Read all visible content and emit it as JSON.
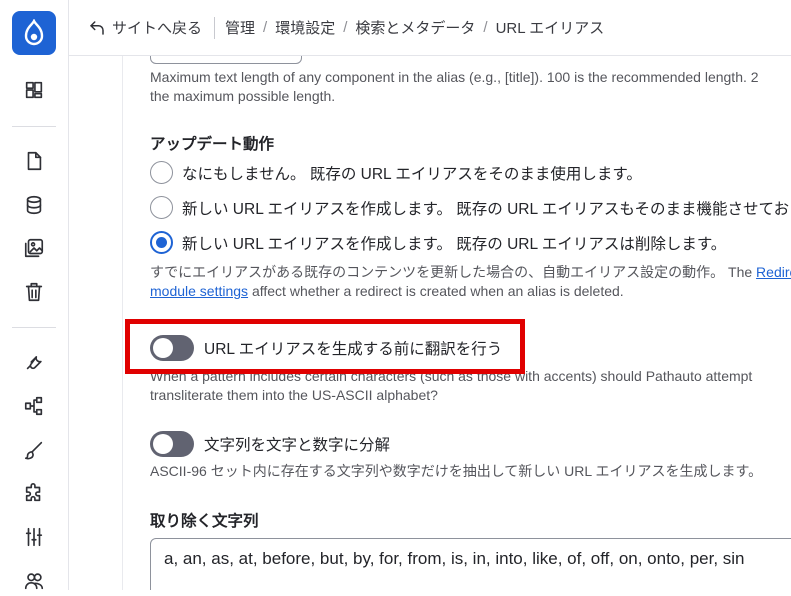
{
  "topbar": {
    "back_label": "サイトへ戻る",
    "breadcrumbs": [
      "管理",
      "環境設定",
      "検索とメタデータ",
      "URL エイリアス"
    ]
  },
  "sidebar": {
    "icons": [
      "drupal-logo-icon",
      "dashboard-icon",
      "content-icon",
      "structure-icon",
      "media-icon",
      "trash-icon",
      "tools-icon",
      "workflow-icon",
      "appearance-icon",
      "extend-icon",
      "configuration-icon",
      "people-icon"
    ]
  },
  "max_component_help": {
    "line1": "Maximum text length of any component in the alias (e.g., [title]). 100 is the recommended length. 2",
    "line2": "the maximum possible length."
  },
  "update_action": {
    "title": "アップデート動作",
    "options": [
      {
        "label": "なにもしません。 既存の URL エイリアスをそのまま使用します。",
        "checked": false
      },
      {
        "label": "新しい URL エイリアスを作成します。 既存の URL エイリアスもそのまま機能させておき",
        "checked": false
      },
      {
        "label": "新しい URL エイリアスを作成します。 既存の URL エイリアスは削除します。",
        "checked": true
      }
    ],
    "help_line1_text": "すでにエイリアスがある既存のコンテンツを更新した場合の、自動エイリアス設定の動作。 The ",
    "help_link_part1": "Redire",
    "help_link_part2": "module settings",
    "help_line2_text": " affect whether a redirect is created when an alias is deleted."
  },
  "transliterate": {
    "label": "URL エイリアスを生成する前に翻訳を行う",
    "enabled": false,
    "help_line1": "When a pattern includes certain characters (such as those with accents) should Pathauto attempt",
    "help_line2": "transliterate them into the US-ASCII alphabet?"
  },
  "reduce_ascii": {
    "label": "文字列を文字と数字に分解",
    "enabled": false,
    "help": "ASCII-96 セット内に存在する文字列や数字だけを抽出して新しい URL エイリアスを生成します。"
  },
  "ignore_words": {
    "title": "取り除く文字列",
    "value": "a, an, as, at, before, but, by, for, from, is, in, into, like, of, off, on, onto, per, sin"
  },
  "colors": {
    "accent": "#1e63d4",
    "highlight": "#e00000",
    "toggle_off": "#616371"
  }
}
